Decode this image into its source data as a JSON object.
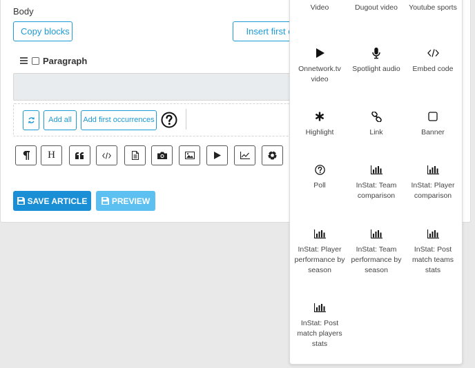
{
  "editor": {
    "body_label": "Body",
    "copy_blocks": "Copy blocks",
    "insert_first": "Insert first occ",
    "paragraph_label": "Paragraph",
    "add_all": "Add all",
    "add_first_occurrences": "Add first occurrences",
    "save_article": "SAVE ARTICLE",
    "preview": "PREVIEW",
    "toolbar_icons": [
      "paragraph-icon",
      "heading-icon",
      "quote-icon",
      "code-icon",
      "document-icon",
      "camera-icon",
      "image-icon",
      "play-icon",
      "chart-icon",
      "football-icon"
    ],
    "heading_glyph": "H"
  },
  "colors": {
    "accent": "#1a8fd5",
    "accent_light": "#5cc0f0",
    "outline": "#1c9ad6"
  },
  "popover": {
    "items": [
      {
        "label": "Video",
        "icon": "video-icon"
      },
      {
        "label": "Dugout video",
        "icon": "dugout-video-icon"
      },
      {
        "label": "Youtube sports",
        "icon": "youtube-icon"
      },
      {
        "label": "Onnetwork.tv video",
        "icon": "play-icon"
      },
      {
        "label": "Spotlight audio",
        "icon": "microphone-icon"
      },
      {
        "label": "Embed code",
        "icon": "code-icon"
      },
      {
        "label": "Highlight",
        "icon": "asterisk-icon"
      },
      {
        "label": "Link",
        "icon": "link-icon"
      },
      {
        "label": "Banner",
        "icon": "square-icon"
      },
      {
        "label": "Poll",
        "icon": "question-circle-icon"
      },
      {
        "label": "InStat: Team comparison",
        "icon": "bar-chart-icon"
      },
      {
        "label": "InStat: Player comparison",
        "icon": "bar-chart-icon"
      },
      {
        "label": "InStat: Player performance by season",
        "icon": "bar-chart-icon"
      },
      {
        "label": "InStat: Team performance by season",
        "icon": "bar-chart-icon"
      },
      {
        "label": "InStat: Post match teams stats",
        "icon": "bar-chart-icon"
      },
      {
        "label": "InStat: Post match players stats",
        "icon": "bar-chart-icon"
      }
    ]
  }
}
